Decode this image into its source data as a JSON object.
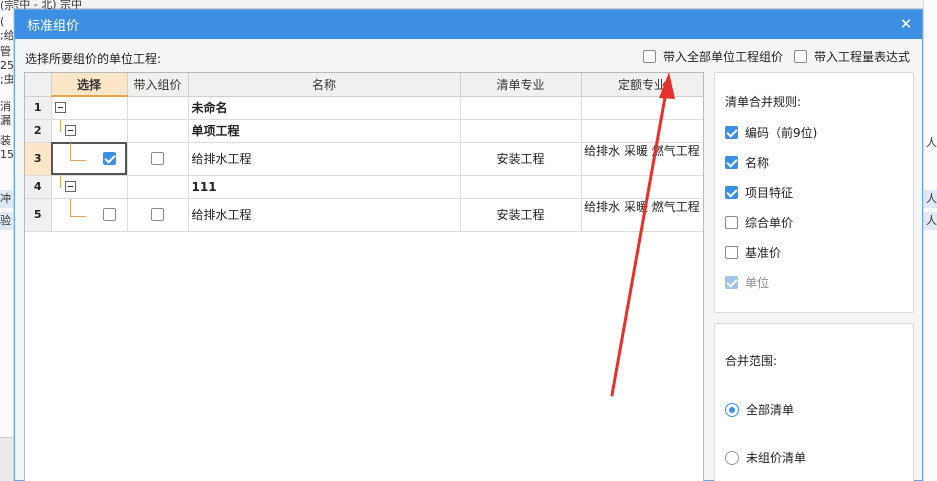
{
  "dialog": {
    "title": "标准组价",
    "close_glyph": "✕"
  },
  "prompt": "选择所要组价的单位工程:",
  "options": {
    "all_units": "带入全部单位工程组价",
    "quantity_expr": "带入工程量表达式"
  },
  "grid": {
    "headers": [
      "",
      "选择",
      "带入组价",
      "名称",
      "清单专业",
      "定额专业"
    ],
    "rows": [
      {
        "num": "1",
        "name": "未命名",
        "list_spec": "",
        "quota_spec": "",
        "has_checkbox": false,
        "selected": false,
        "bring": false,
        "bold": true
      },
      {
        "num": "2",
        "name": "单项工程",
        "list_spec": "",
        "quota_spec": "",
        "has_checkbox": false,
        "selected": false,
        "bring": false,
        "bold": true
      },
      {
        "num": "3",
        "name": "给排水工程",
        "list_spec": "安装工程",
        "quota_spec": "给排水 采暖 燃气工程",
        "has_checkbox": true,
        "selected": true,
        "bring": false,
        "bold": false
      },
      {
        "num": "4",
        "name": "111",
        "list_spec": "",
        "quota_spec": "",
        "has_checkbox": false,
        "selected": false,
        "bring": false,
        "bold": true
      },
      {
        "num": "5",
        "name": "给排水工程",
        "list_spec": "安装工程",
        "quota_spec": "给排水 采暖 燃气工程",
        "has_checkbox": true,
        "selected": false,
        "bring": false,
        "bold": false
      }
    ]
  },
  "merge_rules": {
    "title": "清单合并规则:",
    "items": [
      {
        "label": "编码（前9位)",
        "checked": true,
        "disabled": false
      },
      {
        "label": "名称",
        "checked": true,
        "disabled": false
      },
      {
        "label": "项目特征",
        "checked": true,
        "disabled": false
      },
      {
        "label": "综合单价",
        "checked": false,
        "disabled": false
      },
      {
        "label": "基准价",
        "checked": false,
        "disabled": false
      },
      {
        "label": "单位",
        "checked": true,
        "disabled": true
      }
    ]
  },
  "merge_scope": {
    "title": "合并范围:",
    "options": [
      {
        "label": "全部清单",
        "selected": true
      },
      {
        "label": "未组价清单",
        "selected": false
      }
    ]
  },
  "background": {
    "left_fragments": [
      "(宗中",
      "(",
      ";给",
      "管",
      "25",
      ";虫",
      "消",
      "漏",
      "装",
      "15",
      "冲",
      "验"
    ],
    "right_fragments": [
      "人工",
      "人工",
      "人工"
    ],
    "top_fragments": [
      "(宗中 - 北) 宗中"
    ]
  },
  "colors": {
    "title_bar": "#3c8fe2",
    "accent": "#3c8fe2",
    "selected_header": "#fbe7c8",
    "annotation_arrow": "#e8302a"
  }
}
